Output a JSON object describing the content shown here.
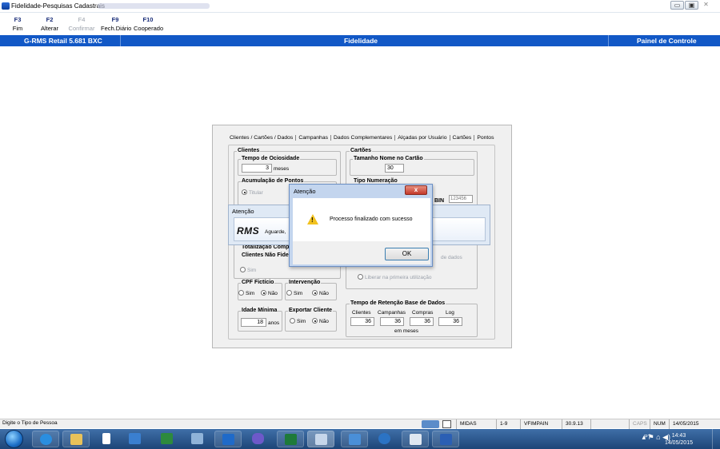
{
  "window": {
    "title": "Fidelidade-Pesquisas Cadastrais",
    "controls": {
      "minimize": "▭",
      "maximize": "▣",
      "close": "✕"
    }
  },
  "fkeys": [
    {
      "key": "F3",
      "label": "Fim"
    },
    {
      "key": "F2",
      "label": "Alterar"
    },
    {
      "key": "F4",
      "label": "Confirmar"
    },
    {
      "key": "F9",
      "label": "Fech.Diário"
    },
    {
      "key": "F10",
      "label": "Cooperado"
    }
  ],
  "header": {
    "left": "G-RMS Retail 5.681 BXC",
    "center": "Fidelidade",
    "right": "Painel de Controle"
  },
  "tabs": [
    "Clientes / Cartões / Dados",
    "Campanhas",
    "Dados Complementares",
    "Alçadas por Usuário",
    "Cartões",
    "Pontos"
  ],
  "form": {
    "clientes_label": "Clientes",
    "ociosidade_label": "Tempo de Ociosidade",
    "ociosidade_value": "3",
    "ociosidade_unit": "meses",
    "acumulacao_label": "Acumulação de Pontos",
    "acumulacao_opt1": "Titular",
    "totalizacao_label1": "Totalização Comp",
    "totalizacao_label2": "Clientes Não Fide",
    "totalizacao_sim": "Sim",
    "cpf_label": "CPF Fictício",
    "intervencao_label": "Intervenção",
    "sim": "Sim",
    "nao": "Não",
    "idade_label": "Idade Mínima",
    "idade_value": "18",
    "idade_unit": "anos",
    "exportar_label": "Exportar Cliente",
    "cartoes_label": "Cartões",
    "tamanho_label": "Tamanho Nome no Cartão",
    "tamanho_value": "30",
    "tipo_label": "Tipo Numeração",
    "bin_label": "BIN",
    "bin_value": "123456",
    "dados_text": "de dados",
    "liberar_text": "Liberar na primeira utilização",
    "retencao_label": "Tempo de Retenção Base de Dados",
    "ret_cols": [
      "Clientes",
      "Campanhas",
      "Compras",
      "Log"
    ],
    "ret_values": [
      "36",
      "36",
      "36",
      "36"
    ],
    "ret_unit": "em meses"
  },
  "aguarde": {
    "title": "Atenção",
    "logo": "RMS",
    "message": "Aguarde,"
  },
  "dialog": {
    "title": "Atenção",
    "close": "x",
    "message": "Processo finalizado com sucesso",
    "ok": "OK"
  },
  "status": {
    "hint": "Digite o Tipo de Pessoa",
    "cells": [
      "MIDAS",
      "1-9",
      "VFIMPAIN",
      "30.9.13",
      "",
      "CAPS",
      "NUM",
      "14/05/2015"
    ]
  },
  "taskbar": {
    "lang": "PT",
    "time": "14:43",
    "date": "14/05/2015"
  }
}
